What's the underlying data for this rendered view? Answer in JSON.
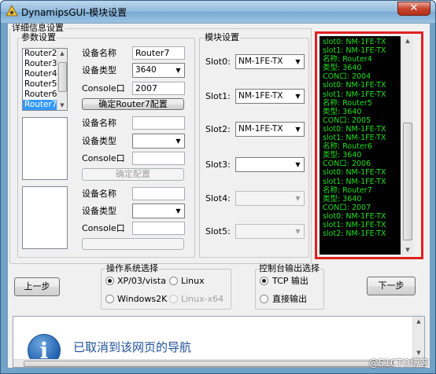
{
  "window": {
    "title": "DynamipsGUI-模块设置",
    "close_glyph": "✕"
  },
  "details_group": {
    "label": "详细信息设置"
  },
  "params_group": {
    "label": "参数设置"
  },
  "router_list": {
    "items": [
      "Router2",
      "Router3",
      "Router4",
      "Router5",
      "Router6",
      "Router7"
    ],
    "selected": "Router7"
  },
  "device1": {
    "name_label": "设备名称",
    "name_value": "Router7",
    "type_label": "设备类型",
    "type_value": "3640",
    "console_label": "Console口",
    "console_value": "2007",
    "confirm_label": "确定Router7配置"
  },
  "device2": {
    "name_label": "设备名称",
    "name_value": "",
    "type_label": "设备类型",
    "type_value": "",
    "console_label": "Console口",
    "console_value": "",
    "confirm_label": "确定配置"
  },
  "device3": {
    "name_label": "设备名称",
    "name_value": "",
    "type_label": "设备类型",
    "type_value": "",
    "console_label": "Console口",
    "console_value": ""
  },
  "module_group": {
    "label": "模块设置",
    "slots": [
      {
        "label": "Slot0:",
        "value": "NM-1FE-TX"
      },
      {
        "label": "Slot1:",
        "value": "NM-1FE-TX"
      },
      {
        "label": "Slot2:",
        "value": "NM-1FE-TX"
      },
      {
        "label": "Slot3:",
        "value": ""
      },
      {
        "label": "Slot4:",
        "value": ""
      },
      {
        "label": "Slot5:",
        "value": ""
      }
    ]
  },
  "console_output": {
    "lines": [
      "slot0: NM-1FE-TX",
      "slot1: NM-1FE-TX",
      "名称: Router4",
      "类型: 3640",
      "CON口: 2004",
      "slot0: NM-1FE-TX",
      "slot1: NM-1FE-TX",
      "名称: Router5",
      "类型: 3640",
      "CON口: 2005",
      "slot0: NM-1FE-TX",
      "slot1: NM-1FE-TX",
      "名称: Router6",
      "类型: 3640",
      "CON口: 2006",
      "slot0: NM-1FE-TX",
      "slot1: NM-1FE-TX",
      "名称: Router7",
      "类型: 3640",
      "CON口: 2007",
      "slot0: NM-1FE-TX",
      "slot1: NM-1FE-TX",
      "slot2: NM-1FE-TX"
    ]
  },
  "nav": {
    "prev_label": "上一步",
    "next_label": "下一步"
  },
  "os_group": {
    "label": "操作系统选择",
    "options": [
      {
        "label": "XP/03/vista",
        "selected": true,
        "enabled": true
      },
      {
        "label": "Linux",
        "selected": false,
        "enabled": true
      },
      {
        "label": "Windows2K",
        "selected": false,
        "enabled": true
      },
      {
        "label": "Linux-x64",
        "selected": false,
        "enabled": false
      }
    ]
  },
  "output_group": {
    "label": "控制台输出选择",
    "options": [
      {
        "label": "TCP 输出",
        "selected": true
      },
      {
        "label": "直接输出",
        "selected": false
      }
    ]
  },
  "browser": {
    "message": "已取消到该网页的导航",
    "icon": "info-icon"
  },
  "watermark": "@51CTO博客",
  "colors": {
    "console_bg": "#000000",
    "console_text": "#22e022",
    "highlight_border": "#e02020",
    "selection": "#3399ff"
  }
}
